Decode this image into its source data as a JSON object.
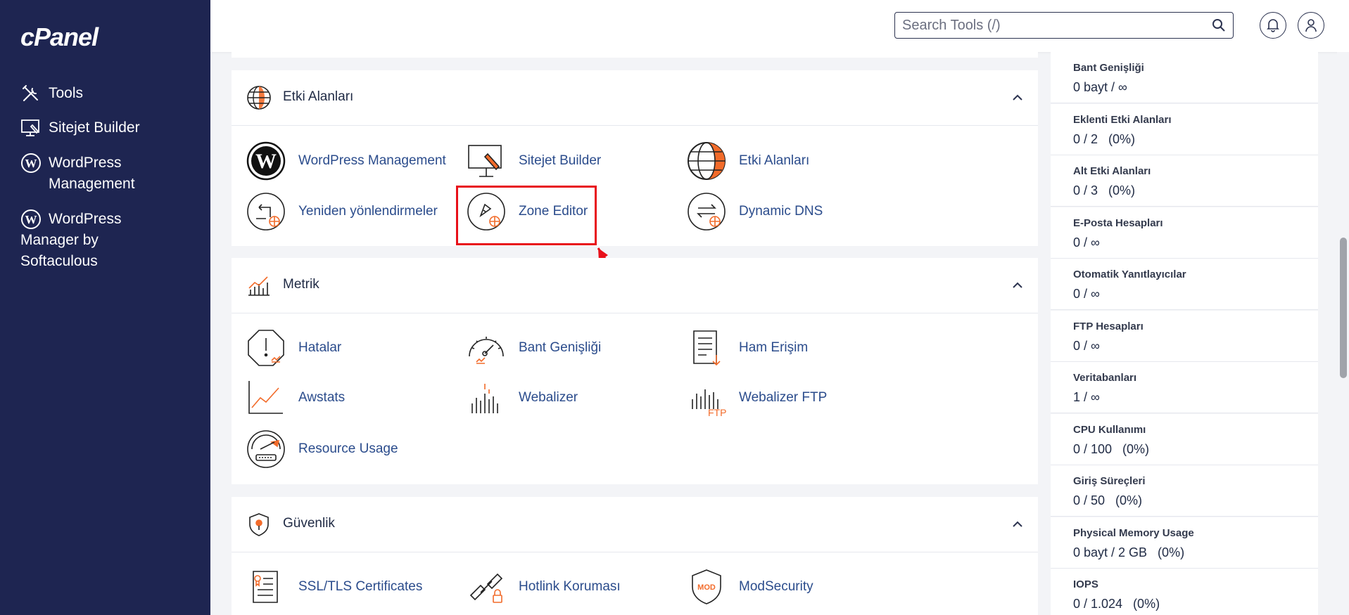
{
  "sidebar": {
    "logo": "cPanel",
    "items": [
      {
        "label": "Tools",
        "icon": "tools-icon"
      },
      {
        "label": "Sitejet Builder",
        "icon": "monitor-icon"
      },
      {
        "label": "WordPress\nManagement",
        "icon": "wordpress-icon"
      },
      {
        "label": "WordPress\n Manager by\nSoftaculous",
        "icon": "wordpress-icon"
      }
    ]
  },
  "header": {
    "search_placeholder": "Search Tools (/)"
  },
  "sections": [
    {
      "title": "Etki Alanları",
      "tools": [
        "WordPress Management",
        "Sitejet Builder",
        "Etki Alanları",
        "Yeniden yönlendirmeler",
        "Zone Editor",
        "Dynamic DNS"
      ]
    },
    {
      "title": "Metrik",
      "tools": [
        "Hatalar",
        "Bant Genişliği",
        "Ham Erişim",
        "Awstats",
        "Webalizer",
        "Webalizer FTP",
        "Resource Usage"
      ]
    },
    {
      "title": "Güvenlik",
      "tools": [
        "SSL/TLS Certificates",
        "Hotlink Koruması",
        "ModSecurity"
      ]
    }
  ],
  "stats": [
    {
      "label": "Bant Genişliği",
      "value": "0 bayt / ∞"
    },
    {
      "label": "Eklenti Etki Alanları",
      "value": "0 / 2   (0%)"
    },
    {
      "label": "Alt Etki Alanları",
      "value": "0 / 3   (0%)"
    },
    {
      "label": "E-Posta Hesapları",
      "value": "0 / ∞"
    },
    {
      "label": "Otomatik Yanıtlayıcılar",
      "value": "0 / ∞"
    },
    {
      "label": "FTP Hesapları",
      "value": "0 / ∞"
    },
    {
      "label": "Veritabanları",
      "value": "1 / ∞"
    },
    {
      "label": "CPU Kullanımı",
      "value": "0 / 100   (0%)"
    },
    {
      "label": "Giriş Süreçleri",
      "value": "0 / 50   (0%)"
    },
    {
      "label": "Physical Memory Usage",
      "value": "0 bayt / 2 GB   (0%)"
    },
    {
      "label": "IOPS",
      "value": "0 / 1.024   (0%)"
    }
  ],
  "colors": {
    "sidebar_bg": "#1e2551",
    "link": "#2b4c8c",
    "accent_orange": "#f26b2a",
    "highlight_red": "#e8101a"
  }
}
